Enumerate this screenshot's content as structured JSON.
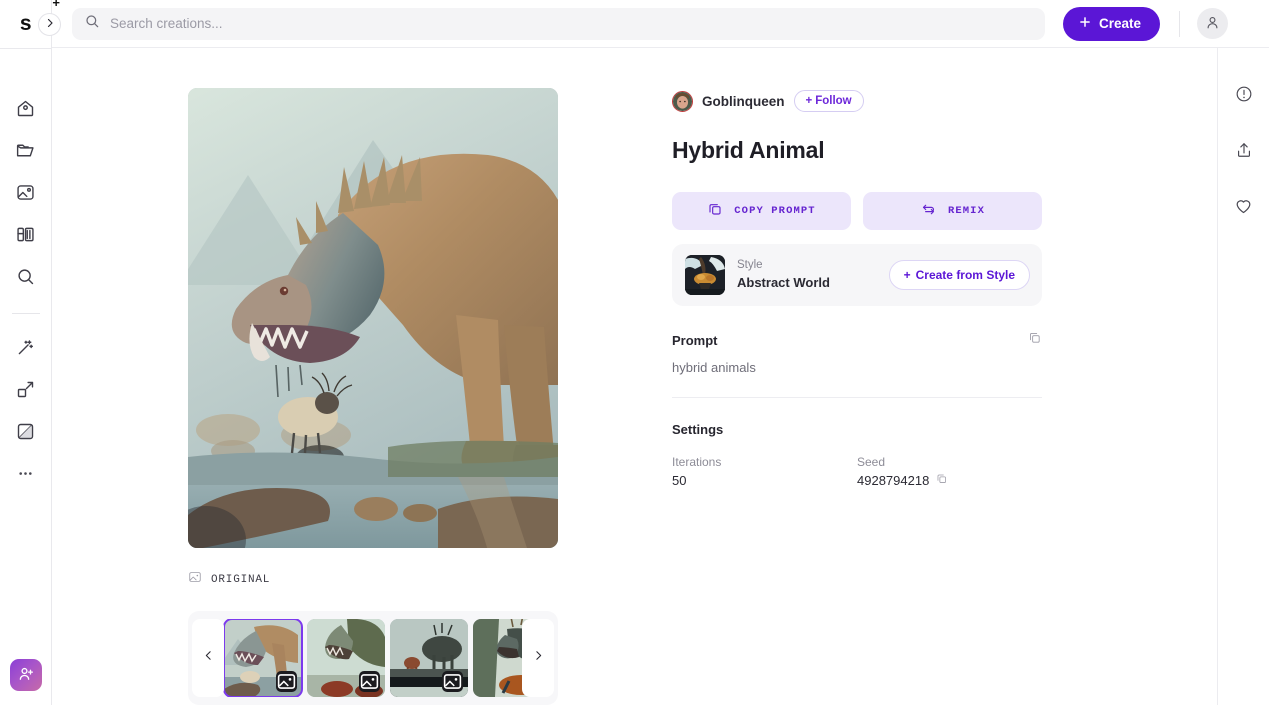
{
  "app": {
    "logo_letter": "s",
    "logo_superscript": "+"
  },
  "topbar": {
    "search_placeholder": "Search creations...",
    "search_value": "",
    "create_label": "Create",
    "create_color": "#5b16d6"
  },
  "sidebar": {
    "items": [
      {
        "name": "home-icon",
        "label": "Home"
      },
      {
        "name": "folder-icon",
        "label": "Projects"
      },
      {
        "name": "image-icon",
        "label": "Creations"
      },
      {
        "name": "styles-icon",
        "label": "Styles"
      },
      {
        "name": "search-icon",
        "label": "Explore"
      },
      {
        "name": "magic-wand-icon",
        "label": "Enhance"
      },
      {
        "name": "upscale-icon",
        "label": "Upscale"
      },
      {
        "name": "background-remove-icon",
        "label": "Background"
      },
      {
        "name": "more-icon",
        "label": "More"
      }
    ],
    "invite_label": "Invite"
  },
  "detail": {
    "author": "Goblinqueen",
    "follow_label": "+ Follow",
    "follow_plus": "+",
    "follow_text": "Follow",
    "title": "Hybrid Animal",
    "actions": [
      {
        "name": "copy-prompt-button",
        "label": "COPY PROMPT",
        "icon": "copy-icon"
      },
      {
        "name": "remix-button",
        "label": "REMIX",
        "icon": "remix-icon"
      }
    ],
    "style": {
      "kicker": "Style",
      "name": "Abstract World",
      "cta_plus": "+",
      "cta_label": "Create from Style"
    },
    "prompt": {
      "heading": "Prompt",
      "text": "hybrid animals"
    },
    "settings": {
      "heading": "Settings",
      "fields": [
        {
          "label": "Iterations",
          "value": "50",
          "copyable": false
        },
        {
          "label": "Seed",
          "value": "4928794218",
          "copyable": true
        }
      ]
    }
  },
  "media": {
    "original_label": "ORIGINAL",
    "prev_arrow": "‹",
    "next_arrow": "›",
    "thumbnails": [
      {
        "name": "thumbnail-1",
        "selected": true
      },
      {
        "name": "thumbnail-2",
        "selected": false
      },
      {
        "name": "thumbnail-3",
        "selected": false
      },
      {
        "name": "thumbnail-4",
        "selected": false
      }
    ]
  },
  "rightrail": {
    "items": [
      {
        "name": "report-icon",
        "label": "Report"
      },
      {
        "name": "share-icon",
        "label": "Share"
      },
      {
        "name": "heart-icon",
        "label": "Like"
      }
    ]
  },
  "colors": {
    "accent": "#5b16d6",
    "accent_soft": "#ece6fb",
    "selected_outline": "#7c3aed"
  }
}
